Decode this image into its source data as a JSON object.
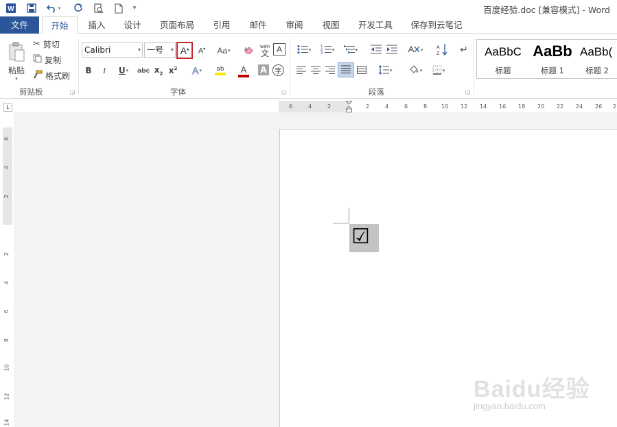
{
  "titlebar": {
    "title": "百度经验.doc [兼容模式] - Word",
    "icons": [
      "word-logo-icon",
      "save-icon",
      "undo-icon",
      "redo-icon",
      "print-preview-icon",
      "new-document-icon",
      "customize-qat-icon"
    ]
  },
  "tabs": [
    {
      "label": "文件"
    },
    {
      "label": "开始"
    },
    {
      "label": "插入"
    },
    {
      "label": "设计"
    },
    {
      "label": "页面布局"
    },
    {
      "label": "引用"
    },
    {
      "label": "邮件"
    },
    {
      "label": "审阅"
    },
    {
      "label": "视图"
    },
    {
      "label": "开发工具"
    },
    {
      "label": "保存到云笔记"
    }
  ],
  "ribbon": {
    "clipboard": {
      "paste": "粘贴",
      "cut": "剪切",
      "copy": "复制",
      "format_painter": "格式刷",
      "group_label": "剪贴板"
    },
    "font": {
      "font_name": "Calibri",
      "font_size": "一号",
      "grow_glyph": "A",
      "shrink_glyph": "A",
      "case_glyph": "Aa",
      "phonetic_glyph": "wén",
      "phonetic_char": "文",
      "border_glyph": "A",
      "bold": "B",
      "italic": "I",
      "underline": "U",
      "strike": "abc",
      "sub": "x",
      "sup": "x",
      "effects_glyph": "A",
      "highlight_glyph": "ab",
      "color_glyph": "A",
      "shading_glyph": "A",
      "enclose_glyph": "字",
      "group_label": "字体"
    },
    "paragraph": {
      "group_label": "段落"
    },
    "styles": [
      {
        "sample": "AaBbC",
        "name": "标题"
      },
      {
        "sample": "AaBb",
        "name": "标题 1"
      },
      {
        "sample": "AaBb(",
        "name": "标题 2"
      }
    ]
  },
  "hruler": {
    "left_labels": [
      "6",
      "4",
      "2"
    ],
    "right_labels": [
      "2",
      "4",
      "6",
      "8",
      "10",
      "12",
      "14",
      "16",
      "18",
      "20",
      "22",
      "24",
      "26",
      "2"
    ]
  },
  "vruler": {
    "labels": [
      "6",
      "4",
      "2",
      "2",
      "4",
      "6",
      "8",
      "10",
      "12",
      "14"
    ]
  },
  "ruler_corner": "L",
  "document": {
    "checkbox": "☑"
  },
  "watermark": {
    "text": "Baidu经验",
    "url": "jingyan.baidu.com"
  },
  "colors": {
    "accent": "#2b579a",
    "highlight": "#ffe600",
    "font_color": "#c00000",
    "selection_box": "#c0272d"
  }
}
